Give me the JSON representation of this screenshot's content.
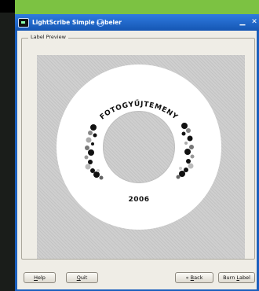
{
  "window": {
    "title": "LightScribe Simple Labeler",
    "minimize_glyph": "▁",
    "close_glyph": "✕"
  },
  "preview": {
    "group_label": "Label Preview",
    "disc": {
      "title_text": "FOTOGYŰJTEMENY",
      "year_text": "2006"
    }
  },
  "buttons": {
    "help": {
      "first": "H",
      "rest": "elp"
    },
    "quit": {
      "first": "Q",
      "rest": "uit"
    },
    "back": {
      "prefix": "« ",
      "first": "B",
      "rest": "ack"
    },
    "burn": {
      "prefix": "Burn ",
      "first": "L",
      "rest": "abel"
    }
  },
  "icons": {
    "app": "lightscribe-app-icon",
    "minimize": "minimize-icon",
    "close": "close-icon"
  },
  "colors": {
    "desktop": "#7cc242",
    "titlebar": "#1b5fbd",
    "client": "#efede6"
  }
}
